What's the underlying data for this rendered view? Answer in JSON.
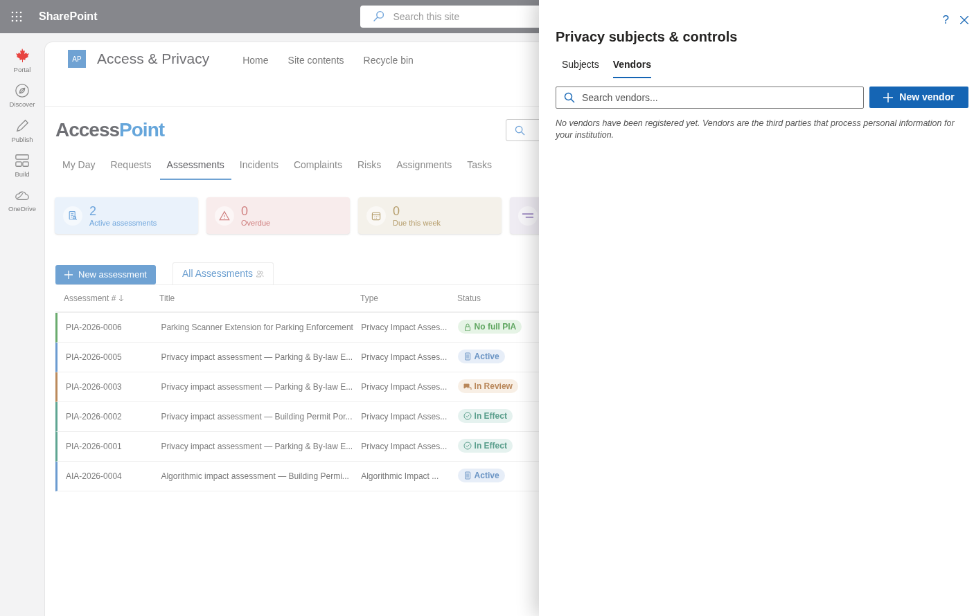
{
  "suite_bar": {
    "app_name": "SharePoint",
    "search": {
      "placeholder": "Search this site"
    }
  },
  "rail": [
    {
      "label": "Portal",
      "kind": "maple"
    },
    {
      "label": "Discover",
      "kind": "compass"
    },
    {
      "label": "Publish",
      "kind": "pen"
    },
    {
      "label": "Build",
      "kind": "build"
    },
    {
      "label": "OneDrive",
      "kind": "cloud"
    }
  ],
  "site": {
    "logo": "AP",
    "title": "Access & Privacy",
    "nav": [
      "Home",
      "Site contents",
      "Recycle bin"
    ]
  },
  "app": {
    "brand_part_1": "Access",
    "brand_part_2": "Point",
    "tabs": [
      {
        "label": "My Day",
        "selected": false
      },
      {
        "label": "Requests",
        "selected": false
      },
      {
        "label": "Assessments",
        "selected": true
      },
      {
        "label": "Incidents",
        "selected": false
      },
      {
        "label": "Complaints",
        "selected": false
      },
      {
        "label": "Risks",
        "selected": false
      },
      {
        "label": "Assignments",
        "selected": false
      },
      {
        "label": "Tasks",
        "selected": false
      }
    ],
    "kpis": [
      {
        "kind": "active",
        "value": "2",
        "label": "Active assessments"
      },
      {
        "kind": "overdue",
        "value": "0",
        "label": "Overdue"
      },
      {
        "kind": "due",
        "value": "0",
        "label": "Due this week"
      },
      {
        "kind": "other"
      }
    ],
    "new_button": "New assessment",
    "view_tab": "All Assessments",
    "table": {
      "columns": [
        "Assessment #",
        "Title",
        "Type",
        "Status"
      ],
      "rows": [
        {
          "color": "#6aab6e",
          "id": "PIA-2026-0006",
          "title": "Parking Scanner Extension for Parking Enforcement",
          "type": "Privacy Impact Asses...",
          "status": {
            "kind": "locked",
            "label": "No full PIA"
          }
        },
        {
          "color": "#6b9bd0",
          "id": "PIA-2026-0005",
          "title": "Privacy impact assessment — Parking & By-law E...",
          "type": "Privacy Impact Asses...",
          "status": {
            "kind": "active",
            "label": "Active"
          }
        },
        {
          "color": "#bb8a5c",
          "id": "PIA-2026-0003",
          "title": "Privacy impact assessment — Parking & By-law E...",
          "type": "Privacy Impact Asses...",
          "status": {
            "kind": "review",
            "label": "In Review"
          }
        },
        {
          "color": "#5fa592",
          "id": "PIA-2026-0002",
          "title": "Privacy impact assessment — Building Permit Por...",
          "type": "Privacy Impact Asses...",
          "status": {
            "kind": "effect",
            "label": "In Effect"
          }
        },
        {
          "color": "#5fa592",
          "id": "PIA-2026-0001",
          "title": "Privacy impact assessment — Parking & By-law E...",
          "type": "Privacy Impact Asses...",
          "status": {
            "kind": "effect",
            "label": "In Effect"
          }
        },
        {
          "color": "#6b9bd0",
          "id": "AIA-2026-0004",
          "title": "Algorithmic impact assessment — Building Permi...",
          "type": "Algorithmic Impact ...",
          "status": {
            "kind": "active",
            "label": "Active"
          }
        }
      ]
    }
  },
  "panel": {
    "help": "?",
    "title": "Privacy subjects & controls",
    "tabs": [
      {
        "label": "Subjects",
        "selected": false
      },
      {
        "label": "Vendors",
        "selected": true
      }
    ],
    "search": {
      "placeholder": "Search vendors..."
    },
    "new_button": "New vendor",
    "empty_text": "No vendors have been registered yet. Vendors are the third parties that process personal information for your institution."
  }
}
